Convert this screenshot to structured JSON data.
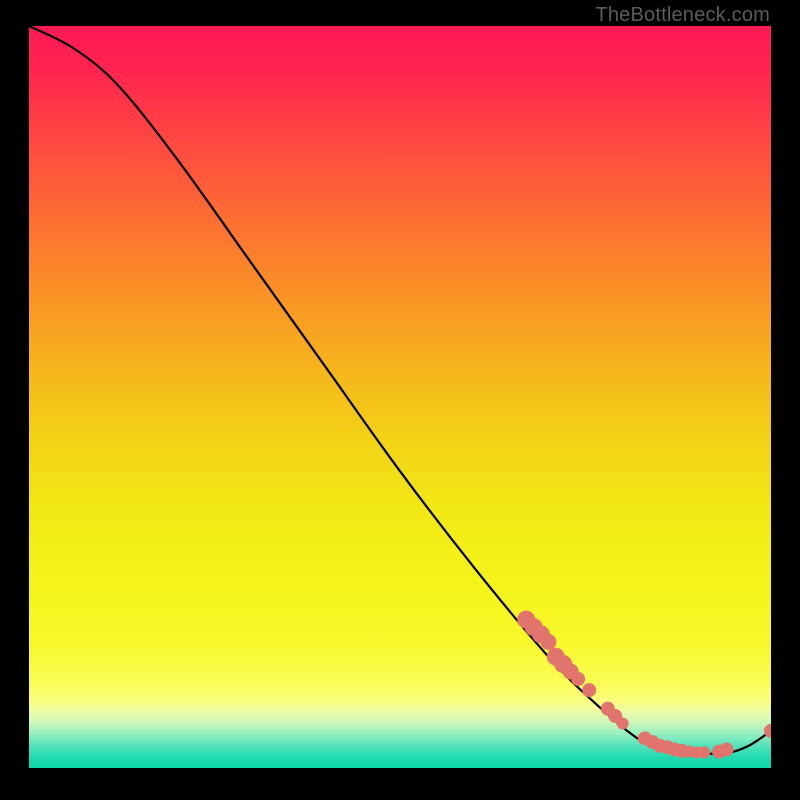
{
  "watermark": "TheBottleneck.com",
  "chart_data": {
    "type": "line",
    "title": "",
    "xlabel": "",
    "ylabel": "",
    "xlim": [
      0,
      100
    ],
    "ylim": [
      0,
      100
    ],
    "description": "Bottleneck-style curve falling diagonally across a vertical rainbow gradient (red top to green bottom), with salmon dots clustered in the lower-right trough.",
    "curve": [
      {
        "x": 0,
        "y": 100
      },
      {
        "x": 6,
        "y": 97
      },
      {
        "x": 12,
        "y": 92
      },
      {
        "x": 20,
        "y": 82
      },
      {
        "x": 30,
        "y": 68
      },
      {
        "x": 40,
        "y": 54
      },
      {
        "x": 50,
        "y": 40
      },
      {
        "x": 60,
        "y": 27
      },
      {
        "x": 70,
        "y": 15
      },
      {
        "x": 76,
        "y": 9
      },
      {
        "x": 82,
        "y": 4
      },
      {
        "x": 86,
        "y": 2.5
      },
      {
        "x": 90,
        "y": 2
      },
      {
        "x": 94,
        "y": 2
      },
      {
        "x": 97,
        "y": 3
      },
      {
        "x": 100,
        "y": 5
      }
    ],
    "points": [
      {
        "x": 67,
        "y": 20,
        "r": 9
      },
      {
        "x": 68,
        "y": 19,
        "r": 9
      },
      {
        "x": 69,
        "y": 18,
        "r": 9
      },
      {
        "x": 70,
        "y": 17,
        "r": 8
      },
      {
        "x": 71,
        "y": 15,
        "r": 9
      },
      {
        "x": 72,
        "y": 14,
        "r": 9
      },
      {
        "x": 73,
        "y": 13,
        "r": 8
      },
      {
        "x": 74,
        "y": 12,
        "r": 7
      },
      {
        "x": 75.5,
        "y": 10.5,
        "r": 7
      },
      {
        "x": 78,
        "y": 8,
        "r": 7
      },
      {
        "x": 79,
        "y": 7,
        "r": 7
      },
      {
        "x": 80,
        "y": 6,
        "r": 6
      },
      {
        "x": 83,
        "y": 4,
        "r": 7
      },
      {
        "x": 84,
        "y": 3.5,
        "r": 7
      },
      {
        "x": 85,
        "y": 3,
        "r": 7
      },
      {
        "x": 86,
        "y": 2.8,
        "r": 7
      },
      {
        "x": 87,
        "y": 2.5,
        "r": 7
      },
      {
        "x": 88,
        "y": 2.3,
        "r": 7
      },
      {
        "x": 89,
        "y": 2.2,
        "r": 6
      },
      {
        "x": 90,
        "y": 2.1,
        "r": 6
      },
      {
        "x": 91,
        "y": 2.1,
        "r": 6
      },
      {
        "x": 93,
        "y": 2.2,
        "r": 7
      },
      {
        "x": 94,
        "y": 2.5,
        "r": 7
      },
      {
        "x": 100,
        "y": 5,
        "r": 7
      }
    ],
    "gradient_stops": [
      {
        "pos": 0.0,
        "color": "#ff1a55"
      },
      {
        "pos": 0.06,
        "color": "#ff2450"
      },
      {
        "pos": 0.15,
        "color": "#ff4642"
      },
      {
        "pos": 0.25,
        "color": "#fd6a34"
      },
      {
        "pos": 0.35,
        "color": "#fa8e27"
      },
      {
        "pos": 0.45,
        "color": "#f6b11d"
      },
      {
        "pos": 0.55,
        "color": "#f3d016"
      },
      {
        "pos": 0.65,
        "color": "#f2e815"
      },
      {
        "pos": 0.75,
        "color": "#f4f41a"
      },
      {
        "pos": 0.83,
        "color": "#f6f82a"
      },
      {
        "pos": 0.885,
        "color": "#f9fc55"
      },
      {
        "pos": 0.91,
        "color": "#fbfe80"
      },
      {
        "pos": 0.925,
        "color": "#ebfca8"
      },
      {
        "pos": 0.94,
        "color": "#c7f7ba"
      },
      {
        "pos": 0.955,
        "color": "#93eec1"
      },
      {
        "pos": 0.97,
        "color": "#54e3bc"
      },
      {
        "pos": 0.985,
        "color": "#22dbaf"
      },
      {
        "pos": 1.0,
        "color": "#0bd7a6"
      }
    ]
  }
}
